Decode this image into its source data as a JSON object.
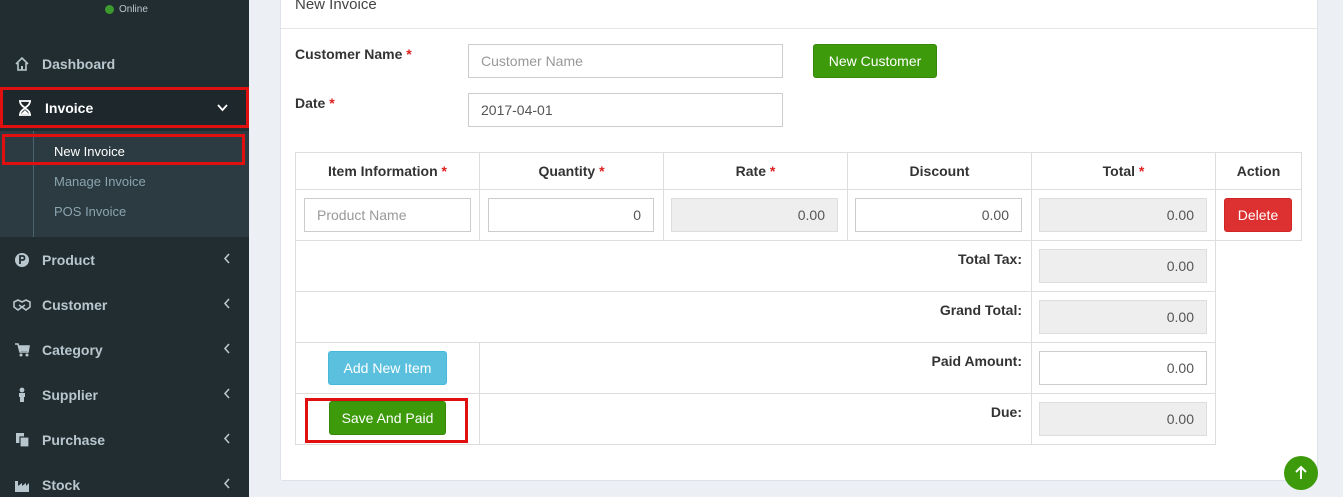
{
  "sidebar": {
    "status": "Online",
    "items": [
      {
        "label": "Dashboard",
        "icon": "home-icon"
      },
      {
        "label": "Invoice",
        "icon": "hourglass-icon"
      },
      {
        "label": "Product",
        "icon": "product-p-icon"
      },
      {
        "label": "Customer",
        "icon": "handshake-icon"
      },
      {
        "label": "Category",
        "icon": "cart-icon"
      },
      {
        "label": "Supplier",
        "icon": "person-icon"
      },
      {
        "label": "Purchase",
        "icon": "copy-icon"
      },
      {
        "label": "Stock",
        "icon": "factory-icon"
      }
    ],
    "invoice_submenu": [
      "New Invoice",
      "Manage Invoice",
      "POS Invoice"
    ]
  },
  "panel": {
    "title": "New Invoice"
  },
  "form": {
    "customer_label": "Customer Name",
    "customer_placeholder": "Customer Name",
    "new_customer_button": "New Customer",
    "date_label": "Date",
    "date_value": "2017-04-01",
    "required_mark": "*"
  },
  "table": {
    "headers": [
      {
        "label": "Item Information",
        "required": true
      },
      {
        "label": "Quantity",
        "required": true
      },
      {
        "label": "Rate",
        "required": true
      },
      {
        "label": "Discount",
        "required": false
      },
      {
        "label": "Total",
        "required": true
      },
      {
        "label": "Action",
        "required": false
      }
    ],
    "row": {
      "product_placeholder": "Product Name",
      "quantity": "0",
      "rate": "0.00",
      "discount": "0.00",
      "total": "0.00",
      "delete_button": "Delete"
    },
    "summary": {
      "total_tax_label": "Total Tax:",
      "total_tax": "0.00",
      "grand_total_label": "Grand Total:",
      "grand_total": "0.00",
      "paid_amount_label": "Paid Amount:",
      "paid_amount": "0.00",
      "due_label": "Due:",
      "due": "0.00"
    },
    "add_new_item_button": "Add New Item",
    "save_and_paid_button": "Save And Paid"
  },
  "colors": {
    "sidebar_bg": "#222d32",
    "accent_green": "#3c9a0b",
    "danger_red": "#dd3030",
    "info_cyan": "#5bc0de",
    "highlight_red": "#e01010"
  }
}
